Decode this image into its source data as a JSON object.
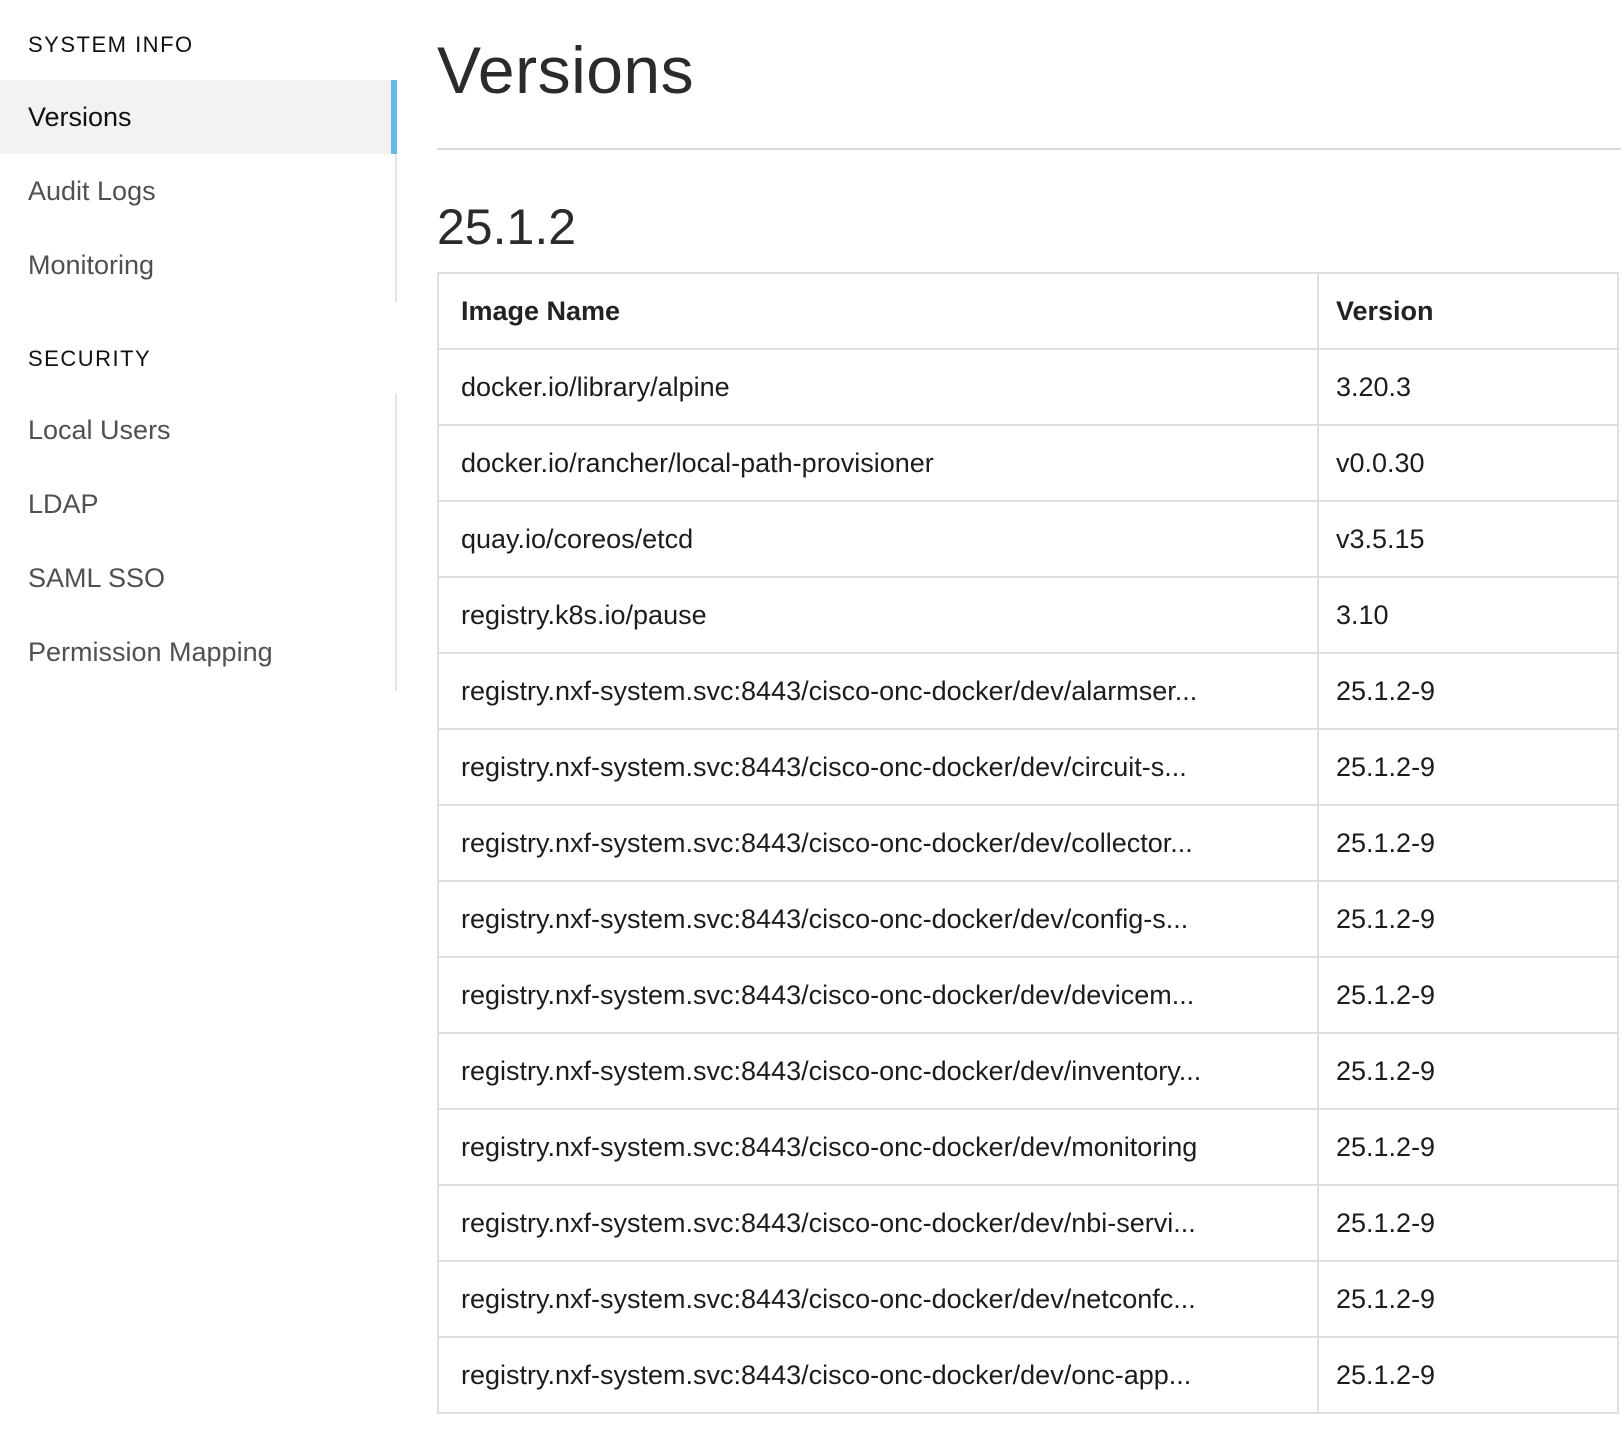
{
  "sidebar": {
    "system_info_title": "SYSTEM INFO",
    "system_info_items": [
      {
        "label": "Versions",
        "active": true
      },
      {
        "label": "Audit Logs",
        "active": false
      },
      {
        "label": "Monitoring",
        "active": false
      }
    ],
    "security_title": "SECURITY",
    "security_items": [
      {
        "label": "Local Users"
      },
      {
        "label": "LDAP"
      },
      {
        "label": "SAML SSO"
      },
      {
        "label": "Permission Mapping"
      }
    ],
    "accent_color": "#64bbe3"
  },
  "main": {
    "title": "Versions",
    "release": "25.1.2",
    "table": {
      "headers": [
        "Image Name",
        "Version"
      ],
      "rows": [
        [
          "docker.io/library/alpine",
          "3.20.3"
        ],
        [
          "docker.io/rancher/local-path-provisioner",
          "v0.0.30"
        ],
        [
          "quay.io/coreos/etcd",
          "v3.5.15"
        ],
        [
          "registry.k8s.io/pause",
          "3.10"
        ],
        [
          "registry.nxf-system.svc:8443/cisco-onc-docker/dev/alarmser...",
          "25.1.2-9"
        ],
        [
          "registry.nxf-system.svc:8443/cisco-onc-docker/dev/circuit-s...",
          "25.1.2-9"
        ],
        [
          "registry.nxf-system.svc:8443/cisco-onc-docker/dev/collector...",
          "25.1.2-9"
        ],
        [
          "registry.nxf-system.svc:8443/cisco-onc-docker/dev/config-s...",
          "25.1.2-9"
        ],
        [
          "registry.nxf-system.svc:8443/cisco-onc-docker/dev/devicem...",
          "25.1.2-9"
        ],
        [
          "registry.nxf-system.svc:8443/cisco-onc-docker/dev/inventory...",
          "25.1.2-9"
        ],
        [
          "registry.nxf-system.svc:8443/cisco-onc-docker/dev/monitoring",
          "25.1.2-9"
        ],
        [
          "registry.nxf-system.svc:8443/cisco-onc-docker/dev/nbi-servi...",
          "25.1.2-9"
        ],
        [
          "registry.nxf-system.svc:8443/cisco-onc-docker/dev/netconfc...",
          "25.1.2-9"
        ],
        [
          "registry.nxf-system.svc:8443/cisco-onc-docker/dev/onc-app...",
          "25.1.2-9"
        ]
      ]
    }
  }
}
